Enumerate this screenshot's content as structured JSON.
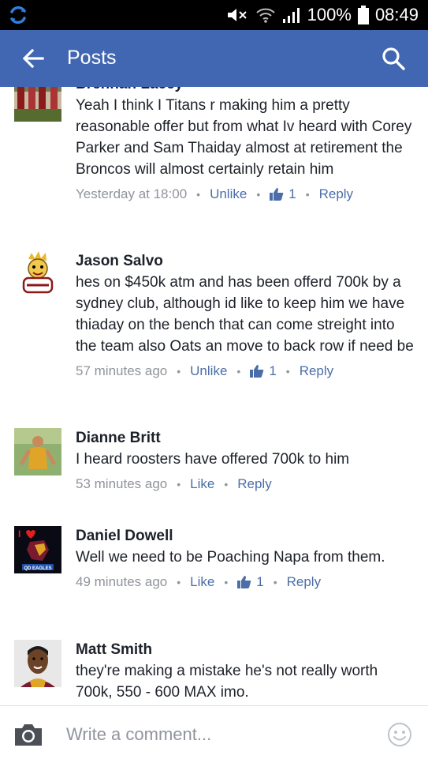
{
  "status_bar": {
    "battery": "100%",
    "time": "08:49"
  },
  "app_bar": {
    "title": "Posts"
  },
  "comments": [
    {
      "name": "Brennan Lacey",
      "text": "Yeah I think I Titans r making him a pretty reasonable offer but from what Iv heard with Corey Parker and Sam Thaiday almost at retirement the Broncos will almost certainly retain him",
      "time": "Yesterday at 18:00",
      "like_action": "Unlike",
      "like_count": "1",
      "reply": "Reply"
    },
    {
      "name": "Jason Salvo",
      "text": "hes on $450k atm and has been offerd 700k by a sydney club, although id like to keep him we have thiaday on the bench that can come streight into the team also Oats an move to back row if need be",
      "time": "57 minutes ago",
      "like_action": "Unlike",
      "like_count": "1",
      "reply": "Reply"
    },
    {
      "name": "Dianne Britt",
      "text": "I heard roosters have offered 700k to him",
      "time": "53 minutes ago",
      "like_action": "Like",
      "like_count": "",
      "reply": "Reply"
    },
    {
      "name": "Daniel Dowell",
      "text": "Well we need to be Poaching Napa from them.",
      "time": "49 minutes ago",
      "like_action": "Like",
      "like_count": "1",
      "reply": "Reply"
    },
    {
      "name": "Matt Smith",
      "text": "they're making a mistake he's not really worth 700k, 550 - 600 MAX imo.",
      "time": "",
      "like_action": "",
      "like_count": "",
      "reply": ""
    }
  ],
  "avatar_badge": {
    "heart_prefix": "I",
    "banner": "QD EAGLES"
  },
  "composer": {
    "placeholder": "Write a comment..."
  },
  "icons": {
    "sync": "sync-icon",
    "mute": "mute-icon",
    "wifi": "wifi-icon",
    "signal": "signal-icon",
    "battery": "battery-icon",
    "back": "back-arrow-icon",
    "search": "search-icon",
    "thumbs_up": "thumbs-up-icon",
    "camera": "camera-icon",
    "emoji": "emoji-icon"
  },
  "colors": {
    "app_bar": "#4267b2",
    "link": "#4b6ea9",
    "meta": "#90949c",
    "text": "#1d2129"
  }
}
